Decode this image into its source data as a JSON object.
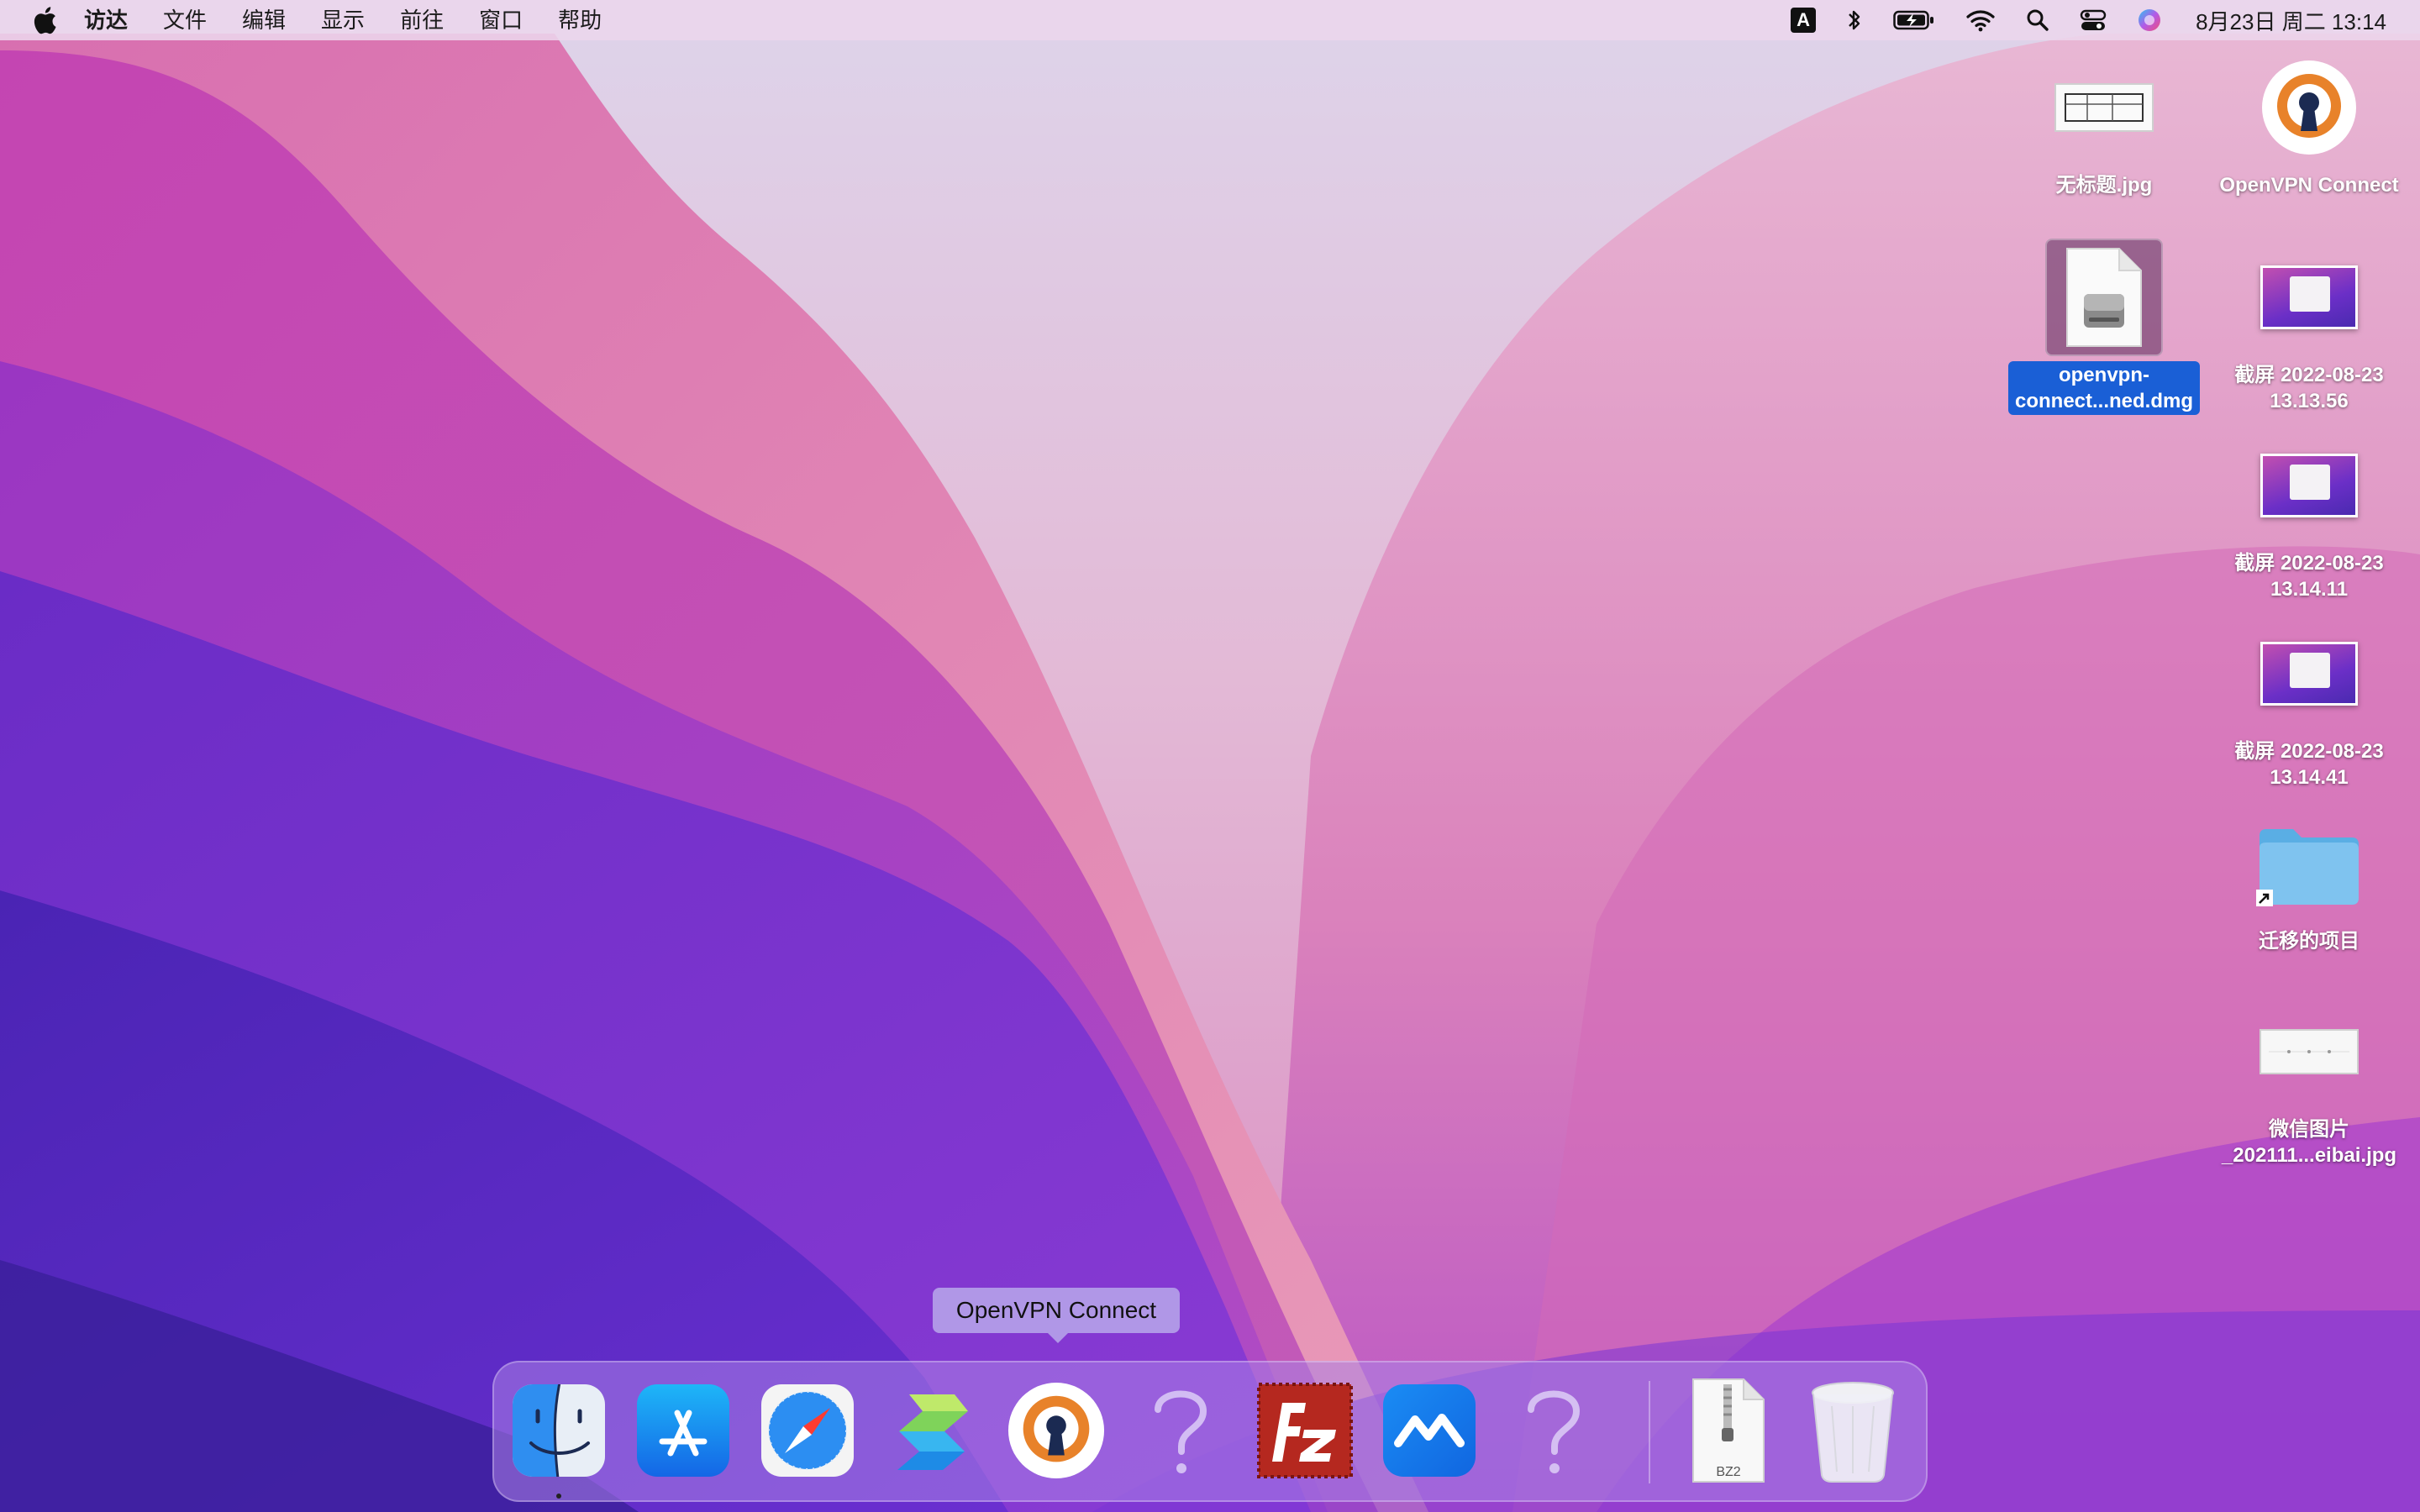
{
  "menubar": {
    "app_name": "访达",
    "menus": [
      "文件",
      "编辑",
      "显示",
      "前往",
      "窗口",
      "帮助"
    ],
    "input_method": "A",
    "clock": "8月23日 周二  13:14"
  },
  "desktop": {
    "icons": [
      {
        "label": "无标题.jpg"
      },
      {
        "label": "OpenVPN Connect"
      },
      {
        "label": "openvpn-\nconnect...ned.dmg"
      },
      {
        "label": "截屏 2022-08-23\n13.13.56"
      },
      {
        "label": "截屏 2022-08-23\n13.14.11"
      },
      {
        "label": "截屏 2022-08-23\n13.14.41"
      },
      {
        "label": "迁移的项目"
      },
      {
        "label": "微信图片\n_202111...eibai.jpg"
      }
    ]
  },
  "tooltip": {
    "text": "OpenVPN Connect"
  },
  "dock": {
    "apps": [
      {
        "name": "finder-icon"
      },
      {
        "name": "app-store-icon"
      },
      {
        "name": "safari-icon"
      },
      {
        "name": "stack-app-icon"
      },
      {
        "name": "openvpn-icon"
      },
      {
        "name": "unknown-app-icon"
      },
      {
        "name": "filezilla-icon"
      },
      {
        "name": "lanhu-icon"
      },
      {
        "name": "unknown-app-icon"
      },
      {
        "name": "bz2-archive-icon"
      },
      {
        "name": "trash-icon"
      }
    ],
    "archive_label": "BZ2"
  },
  "colors": {
    "menubar_bg": "#ecd6ec",
    "selection_blue": "#1a5fd6",
    "openvpn_orange": "#e8822a",
    "filezilla_red": "#b5281f"
  }
}
